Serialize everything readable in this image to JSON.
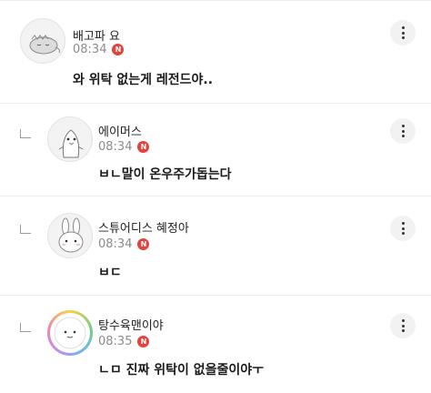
{
  "comments": [
    {
      "nickname": "배고파 요",
      "time": "08:34",
      "badge": "N",
      "text": "와 위탁 없는게 레전드야..",
      "avatar_icon": "sleeping-dinosaur-avatar",
      "is_reply": false
    },
    {
      "nickname": "에이머스",
      "time": "08:34",
      "badge": "N",
      "text": "ㅂㄴ말이 온우주가돕는다",
      "avatar_icon": "penguin-avatar",
      "is_reply": true
    },
    {
      "nickname": "스튜어디스 혜정아",
      "time": "08:34",
      "badge": "N",
      "text": "ㅂㄷ",
      "avatar_icon": "rabbit-avatar",
      "is_reply": true
    },
    {
      "nickname": "탕수육맨이야",
      "time": "08:35",
      "badge": "N",
      "text": "ㄴㅁ 진짜 위탁이 없을줄이야ㅜ",
      "avatar_icon": "round-face-avatar",
      "is_reply": true
    }
  ],
  "colors": {
    "badge": "#e8413d",
    "divider": "#ececec",
    "time": "#8c8c8c"
  }
}
